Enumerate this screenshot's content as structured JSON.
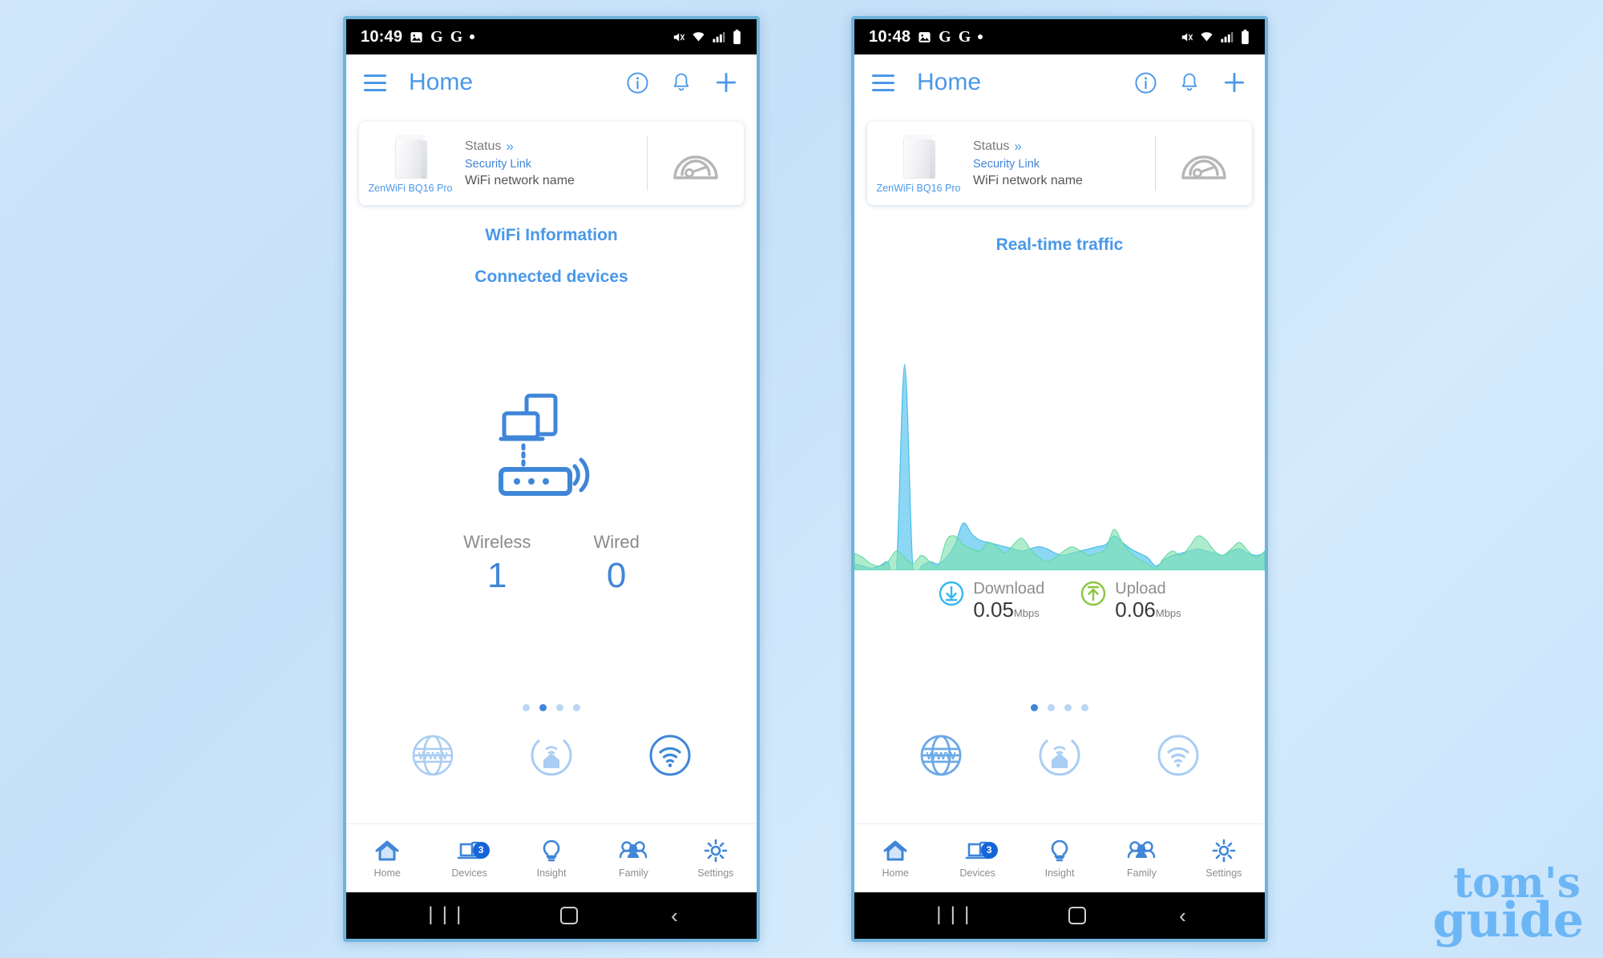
{
  "background": {
    "accent": "#4a98e8",
    "page_bg": "#cfe6fa"
  },
  "watermark": {
    "line1": "tom's",
    "line2": "guide"
  },
  "phones": [
    {
      "id": "left",
      "status_bar": {
        "time": "10:49",
        "icons": [
          "image-icon",
          "google-g-icon",
          "google-g-icon",
          "dot-icon"
        ],
        "right_icons": [
          "mute-icon",
          "wifi-icon",
          "signal-icon",
          "battery-icon"
        ]
      },
      "app_bar": {
        "menu_icon": "hamburger-icon",
        "title": "Home",
        "actions": [
          "info-icon",
          "bell-icon",
          "plus-icon"
        ]
      },
      "router_card": {
        "device_name": "ZenWiFi BQ16 Pro",
        "status_label": "Status",
        "status_chevron": "»",
        "security_link": "Security Link",
        "ssid": "WiFi network name",
        "speedometer_icon": "speedometer-icon"
      },
      "links": [
        "WiFi Information",
        "Connected devices"
      ],
      "illustration": "router-and-devices-icon",
      "counts": [
        {
          "label": "Wireless",
          "value": "1"
        },
        {
          "label": "Wired",
          "value": "0"
        }
      ],
      "page_dots": {
        "count": 4,
        "active_index": 1
      },
      "quick_icons": [
        "www-globe-icon",
        "home-wifi-icon",
        "wifi-circle-icon"
      ],
      "bottom_nav": [
        {
          "label": "Home",
          "icon": "home-icon",
          "badge": null,
          "active": true
        },
        {
          "label": "Devices",
          "icon": "laptop-icon",
          "badge": "3",
          "active": false
        },
        {
          "label": "Insight",
          "icon": "bulb-icon",
          "badge": null,
          "active": false
        },
        {
          "label": "Family",
          "icon": "family-icon",
          "badge": null,
          "active": false
        },
        {
          "label": "Settings",
          "icon": "gear-icon",
          "badge": null,
          "active": false
        }
      ],
      "android_nav": [
        "recents-icon",
        "home-square-icon",
        "back-icon"
      ]
    },
    {
      "id": "right",
      "status_bar": {
        "time": "10:48",
        "icons": [
          "image-icon",
          "google-g-icon",
          "google-g-icon",
          "dot-icon"
        ],
        "right_icons": [
          "mute-icon",
          "wifi-icon",
          "signal-icon",
          "battery-icon"
        ]
      },
      "app_bar": {
        "menu_icon": "hamburger-icon",
        "title": "Home",
        "actions": [
          "info-icon",
          "bell-icon",
          "plus-icon"
        ]
      },
      "router_card": {
        "device_name": "ZenWiFi BQ16 Pro",
        "status_label": "Status",
        "status_chevron": "»",
        "security_link": "Security Link",
        "ssid": "WiFi network name",
        "speedometer_icon": "speedometer-icon"
      },
      "section_title": "Real-time traffic",
      "speeds": [
        {
          "label": "Download",
          "value": "0.05",
          "unit": "Mbps",
          "icon": "download-arrow-icon",
          "color": "#35b7ef"
        },
        {
          "label": "Upload",
          "value": "0.06",
          "unit": "Mbps",
          "icon": "upload-arrow-icon",
          "color": "#8ac63f"
        }
      ],
      "page_dots": {
        "count": 4,
        "active_index": 0
      },
      "quick_icons": [
        "www-globe-icon",
        "home-wifi-icon",
        "wifi-circle-icon"
      ],
      "bottom_nav": [
        {
          "label": "Home",
          "icon": "home-icon",
          "badge": null,
          "active": true
        },
        {
          "label": "Devices",
          "icon": "laptop-icon",
          "badge": "3",
          "active": false
        },
        {
          "label": "Insight",
          "icon": "bulb-icon",
          "badge": null,
          "active": false
        },
        {
          "label": "Family",
          "icon": "family-icon",
          "badge": null,
          "active": false
        },
        {
          "label": "Settings",
          "icon": "gear-icon",
          "badge": null,
          "active": false
        }
      ],
      "android_nav": [
        "recents-icon",
        "home-square-icon",
        "back-icon"
      ]
    }
  ],
  "chart_data": {
    "type": "area",
    "title": "Real-time traffic",
    "xlabel": "",
    "ylabel": "",
    "ylim": [
      0,
      100
    ],
    "grid": false,
    "legend": "below-chart",
    "series": [
      {
        "name": "Download",
        "color": "#5ec8f0",
        "fill_opacity": 0.72,
        "values": [
          3,
          2,
          1,
          2,
          4,
          0,
          96,
          0,
          2,
          4,
          3,
          6,
          12,
          22,
          17,
          14,
          13,
          12,
          11,
          10,
          9,
          10,
          11,
          10,
          8,
          7,
          8,
          9,
          10,
          11,
          12,
          16,
          13,
          10,
          8,
          6,
          2,
          5,
          7,
          8,
          9,
          10,
          9,
          8,
          7,
          9,
          10,
          8,
          7,
          8
        ]
      },
      {
        "name": "Upload",
        "color": "#7ee0ae",
        "fill_opacity": 0.62,
        "values": [
          8,
          6,
          3,
          2,
          4,
          9,
          6,
          3,
          7,
          4,
          2,
          14,
          16,
          12,
          10,
          9,
          13,
          11,
          8,
          12,
          15,
          10,
          6,
          4,
          6,
          9,
          11,
          9,
          7,
          8,
          10,
          19,
          13,
          8,
          5,
          3,
          1,
          6,
          9,
          7,
          11,
          16,
          14,
          9,
          7,
          10,
          13,
          9,
          6,
          9
        ]
      }
    ]
  }
}
